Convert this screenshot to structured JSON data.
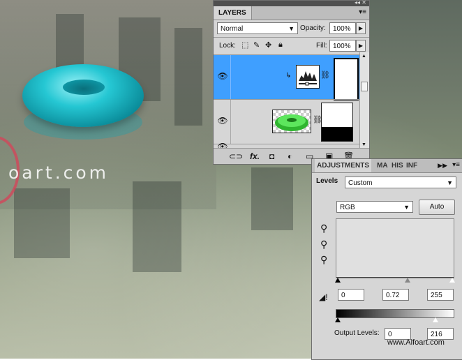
{
  "canvas": {
    "watermark": "oart.com"
  },
  "layers_panel": {
    "tab": "LAYERS",
    "blend_mode": "Normal",
    "opacity_label": "Opacity:",
    "opacity_value": "100%",
    "lock_label": "Lock:",
    "fill_label": "Fill:",
    "fill_value": "100%"
  },
  "adjustments_panel": {
    "tabs": [
      "ADJUSTMENTS",
      "MA",
      "HIS",
      "INF"
    ],
    "preset_label": "Levels",
    "preset_value": "Custom",
    "channel": "RGB",
    "auto_label": "Auto",
    "input_levels": [
      "0",
      "0.72",
      "255"
    ],
    "output_label": "Output Levels:",
    "output_levels": [
      "0",
      "216"
    ]
  },
  "footer_watermark": "www.Alfoart.com",
  "colors": {
    "selected_layer": "#3f9fff",
    "panel_bg": "#d6d6d6"
  }
}
